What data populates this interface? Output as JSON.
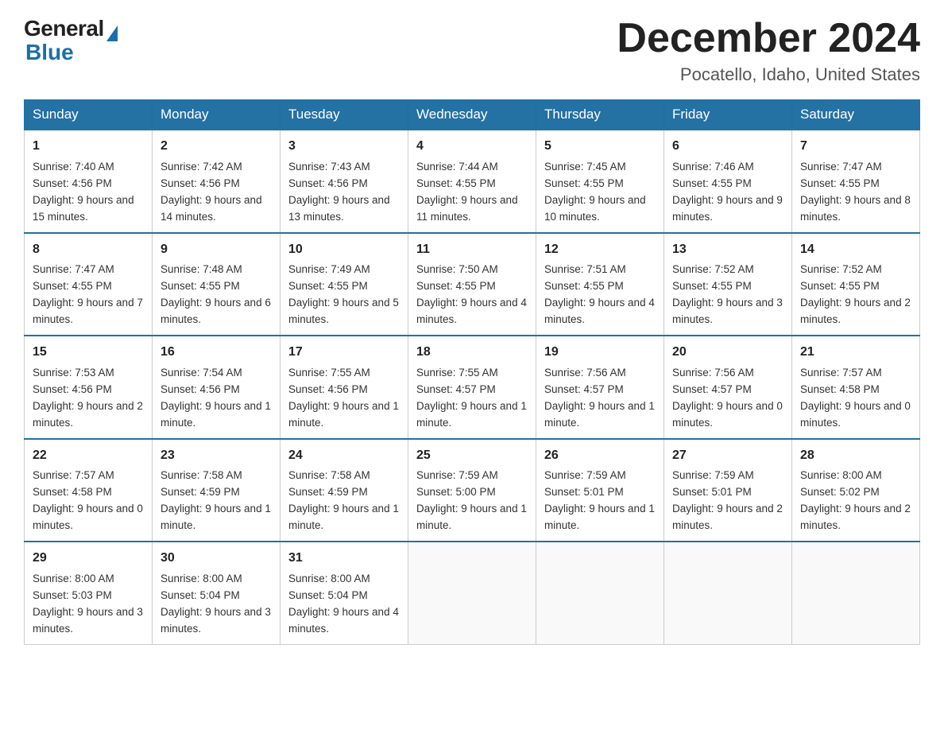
{
  "header": {
    "logo_general": "General",
    "logo_blue": "Blue",
    "month_title": "December 2024",
    "location": "Pocatello, Idaho, United States"
  },
  "days_of_week": [
    "Sunday",
    "Monday",
    "Tuesday",
    "Wednesday",
    "Thursday",
    "Friday",
    "Saturday"
  ],
  "weeks": [
    [
      {
        "day": "1",
        "sunrise": "7:40 AM",
        "sunset": "4:56 PM",
        "daylight": "9 hours and 15 minutes."
      },
      {
        "day": "2",
        "sunrise": "7:42 AM",
        "sunset": "4:56 PM",
        "daylight": "9 hours and 14 minutes."
      },
      {
        "day": "3",
        "sunrise": "7:43 AM",
        "sunset": "4:56 PM",
        "daylight": "9 hours and 13 minutes."
      },
      {
        "day": "4",
        "sunrise": "7:44 AM",
        "sunset": "4:55 PM",
        "daylight": "9 hours and 11 minutes."
      },
      {
        "day": "5",
        "sunrise": "7:45 AM",
        "sunset": "4:55 PM",
        "daylight": "9 hours and 10 minutes."
      },
      {
        "day": "6",
        "sunrise": "7:46 AM",
        "sunset": "4:55 PM",
        "daylight": "9 hours and 9 minutes."
      },
      {
        "day": "7",
        "sunrise": "7:47 AM",
        "sunset": "4:55 PM",
        "daylight": "9 hours and 8 minutes."
      }
    ],
    [
      {
        "day": "8",
        "sunrise": "7:47 AM",
        "sunset": "4:55 PM",
        "daylight": "9 hours and 7 minutes."
      },
      {
        "day": "9",
        "sunrise": "7:48 AM",
        "sunset": "4:55 PM",
        "daylight": "9 hours and 6 minutes."
      },
      {
        "day": "10",
        "sunrise": "7:49 AM",
        "sunset": "4:55 PM",
        "daylight": "9 hours and 5 minutes."
      },
      {
        "day": "11",
        "sunrise": "7:50 AM",
        "sunset": "4:55 PM",
        "daylight": "9 hours and 4 minutes."
      },
      {
        "day": "12",
        "sunrise": "7:51 AM",
        "sunset": "4:55 PM",
        "daylight": "9 hours and 4 minutes."
      },
      {
        "day": "13",
        "sunrise": "7:52 AM",
        "sunset": "4:55 PM",
        "daylight": "9 hours and 3 minutes."
      },
      {
        "day": "14",
        "sunrise": "7:52 AM",
        "sunset": "4:55 PM",
        "daylight": "9 hours and 2 minutes."
      }
    ],
    [
      {
        "day": "15",
        "sunrise": "7:53 AM",
        "sunset": "4:56 PM",
        "daylight": "9 hours and 2 minutes."
      },
      {
        "day": "16",
        "sunrise": "7:54 AM",
        "sunset": "4:56 PM",
        "daylight": "9 hours and 1 minute."
      },
      {
        "day": "17",
        "sunrise": "7:55 AM",
        "sunset": "4:56 PM",
        "daylight": "9 hours and 1 minute."
      },
      {
        "day": "18",
        "sunrise": "7:55 AM",
        "sunset": "4:57 PM",
        "daylight": "9 hours and 1 minute."
      },
      {
        "day": "19",
        "sunrise": "7:56 AM",
        "sunset": "4:57 PM",
        "daylight": "9 hours and 1 minute."
      },
      {
        "day": "20",
        "sunrise": "7:56 AM",
        "sunset": "4:57 PM",
        "daylight": "9 hours and 0 minutes."
      },
      {
        "day": "21",
        "sunrise": "7:57 AM",
        "sunset": "4:58 PM",
        "daylight": "9 hours and 0 minutes."
      }
    ],
    [
      {
        "day": "22",
        "sunrise": "7:57 AM",
        "sunset": "4:58 PM",
        "daylight": "9 hours and 0 minutes."
      },
      {
        "day": "23",
        "sunrise": "7:58 AM",
        "sunset": "4:59 PM",
        "daylight": "9 hours and 1 minute."
      },
      {
        "day": "24",
        "sunrise": "7:58 AM",
        "sunset": "4:59 PM",
        "daylight": "9 hours and 1 minute."
      },
      {
        "day": "25",
        "sunrise": "7:59 AM",
        "sunset": "5:00 PM",
        "daylight": "9 hours and 1 minute."
      },
      {
        "day": "26",
        "sunrise": "7:59 AM",
        "sunset": "5:01 PM",
        "daylight": "9 hours and 1 minute."
      },
      {
        "day": "27",
        "sunrise": "7:59 AM",
        "sunset": "5:01 PM",
        "daylight": "9 hours and 2 minutes."
      },
      {
        "day": "28",
        "sunrise": "8:00 AM",
        "sunset": "5:02 PM",
        "daylight": "9 hours and 2 minutes."
      }
    ],
    [
      {
        "day": "29",
        "sunrise": "8:00 AM",
        "sunset": "5:03 PM",
        "daylight": "9 hours and 3 minutes."
      },
      {
        "day": "30",
        "sunrise": "8:00 AM",
        "sunset": "5:04 PM",
        "daylight": "9 hours and 3 minutes."
      },
      {
        "day": "31",
        "sunrise": "8:00 AM",
        "sunset": "5:04 PM",
        "daylight": "9 hours and 4 minutes."
      },
      null,
      null,
      null,
      null
    ]
  ]
}
